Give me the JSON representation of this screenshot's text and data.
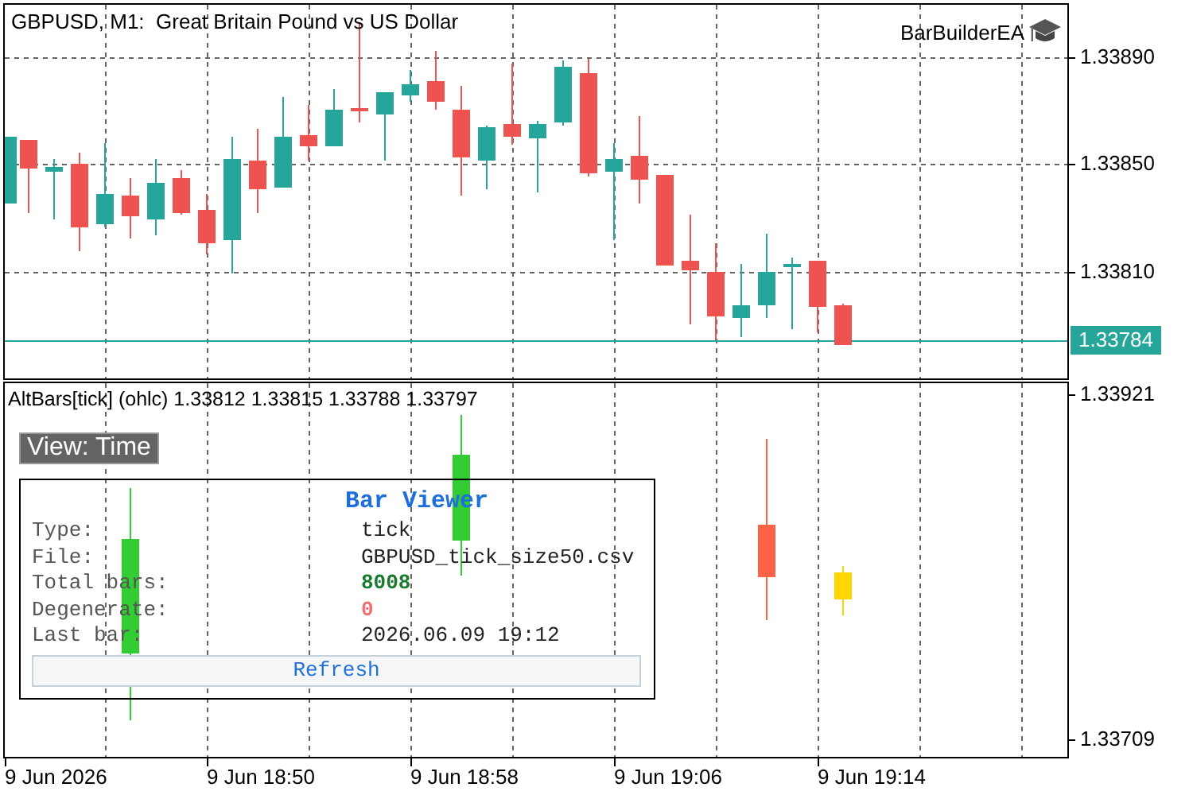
{
  "chart": {
    "title": "GBPUSD, M1:  Great Britain Pound vs US Dollar",
    "expert": "BarBuilderEA",
    "price_labels": [
      "1.33890",
      "1.33850",
      "1.33810"
    ],
    "current_price": "1.33784"
  },
  "subwindow": {
    "indicator_label": "AltBars[tick] (ohlc) 1.33812 1.33815 1.33788 1.33797",
    "price_labels": [
      "1.33921",
      "1.33709"
    ],
    "view_button": "View: Time",
    "panel": {
      "title": "Bar Viewer",
      "rows": [
        {
          "label": "Type:",
          "value": "tick",
          "kind": "plain"
        },
        {
          "label": "File:",
          "value": "GBPUSD_tick_size50.csv",
          "kind": "plain"
        },
        {
          "label": "Total bars:",
          "value": "8008",
          "kind": "good"
        },
        {
          "label": "Degenerate:",
          "value": "0",
          "kind": "bad"
        },
        {
          "label": "Last bar:",
          "value": "2026.06.09 19:12",
          "kind": "plain"
        }
      ],
      "button": "Refresh"
    }
  },
  "time_axis": [
    "9 Jun 2026",
    "9 Jun 18:50",
    "9 Jun 18:58",
    "9 Jun 19:06",
    "9 Jun 19:14"
  ]
}
